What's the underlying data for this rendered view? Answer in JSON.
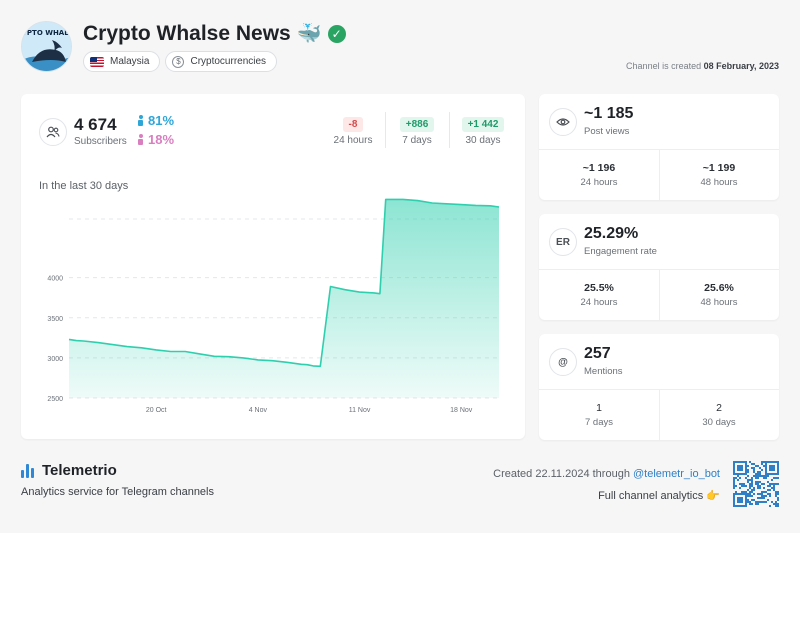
{
  "header": {
    "channel_name": "Crypto Whalse News",
    "title_emoji": "🐳",
    "verified_icon": "verified-check-icon",
    "avatar_text": "YPTO WHALL",
    "tags": [
      {
        "label": "Malaysia",
        "icon": "malaysia-flag-icon"
      },
      {
        "label": "Cryptocurrencies",
        "icon": "coin-icon"
      }
    ],
    "created_prefix": "Channel is created",
    "created_date": "08 February, 2023"
  },
  "subscribers": {
    "count": "4 674",
    "label": "Subscribers",
    "male_pct": "81%",
    "female_pct": "18%",
    "deltas": [
      {
        "value": "-8",
        "label": "24 hours",
        "tone": "negative"
      },
      {
        "value": "+886",
        "label": "7 days",
        "tone": "positive"
      },
      {
        "value": "+1 442",
        "label": "30 days",
        "tone": "positive"
      }
    ]
  },
  "chart_title": "In the last 30 days",
  "chart_data": {
    "type": "area",
    "title": "In the last 30 days",
    "xlabel": "",
    "ylabel": "",
    "x_ticks": [
      "20 Oct",
      "4 Nov",
      "11 Nov",
      "18 Nov"
    ],
    "y_ticks": [
      2500,
      3000,
      3500,
      4000
    ],
    "ylim": [
      2500,
      4980
    ],
    "x": [
      0,
      0.5,
      1,
      2,
      3,
      4,
      5,
      6,
      7,
      8,
      9,
      10,
      11,
      12,
      13,
      14,
      15,
      16,
      16.4,
      16.8,
      17.3,
      18,
      19,
      20,
      21,
      21.4,
      21.8,
      23,
      24,
      25,
      26,
      27,
      28,
      29,
      29.6
    ],
    "values": [
      3230,
      3215,
      3210,
      3190,
      3165,
      3140,
      3125,
      3100,
      3080,
      3080,
      3050,
      3020,
      3015,
      3000,
      2975,
      2965,
      2945,
      2920,
      2915,
      2900,
      2895,
      3890,
      3850,
      3820,
      3810,
      3800,
      4975,
      4975,
      4960,
      4930,
      4920,
      4910,
      4900,
      4895,
      4880
    ],
    "color": "#2fcfae",
    "grid": true,
    "legend": "none"
  },
  "stats": [
    {
      "icon": "eye-icon",
      "icon_text": "",
      "value": "~1 185",
      "label": "Post views",
      "cells": [
        {
          "value": "~1 196",
          "label": "24 hours"
        },
        {
          "value": "~1 199",
          "label": "48 hours"
        }
      ]
    },
    {
      "icon": "er-icon",
      "icon_text": "ER",
      "value": "25.29%",
      "label": "Engagement rate",
      "cells": [
        {
          "value": "25.5%",
          "label": "24 hours"
        },
        {
          "value": "25.6%",
          "label": "48 hours"
        }
      ]
    },
    {
      "icon": "at-icon",
      "icon_text": "@",
      "value": "257",
      "label": "Mentions",
      "cells": [
        {
          "value": "1",
          "label": "7 days"
        },
        {
          "value": "2",
          "label": "30 days"
        }
      ]
    }
  ],
  "footer": {
    "brand": "Telemetrio",
    "tagline": "Analytics service for Telegram channels",
    "created_prefix": "Created 22.11.2024 through ",
    "bot_link": "@telemetr_io_bot",
    "full_analytics": "Full channel analytics 👉",
    "qr_icon": "qr-code-icon"
  },
  "colors": {
    "accent_teal": "#2fcfae",
    "male": "#2fa6d8",
    "female": "#d97fc0",
    "negative": "#d24b4b",
    "positive": "#1f9a6a",
    "link": "#2f7fc6"
  }
}
